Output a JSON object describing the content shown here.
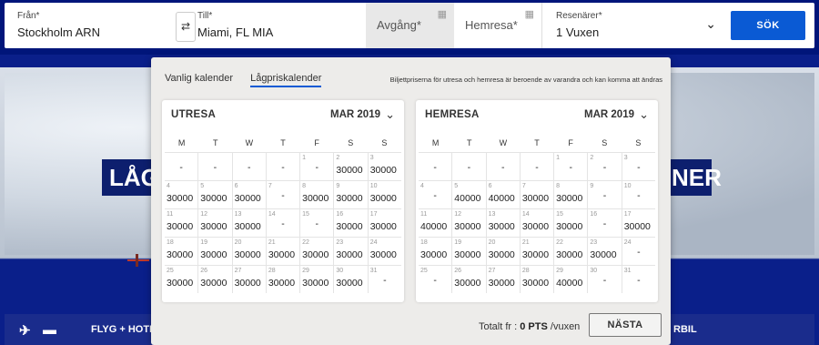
{
  "search": {
    "from_label": "Från*",
    "from_value": "Stockholm ARN",
    "to_label": "Till*",
    "to_value": "Miami, FL MIA",
    "departure_placeholder": "Avgång*",
    "return_placeholder": "Hemresa*",
    "pax_label": "Resenärer*",
    "pax_value": "1 Vuxen",
    "search_button": "SÖK"
  },
  "background": {
    "banner_left": "LÅG",
    "banner_right": "NER",
    "nav_left": "FLYG + HOTE",
    "nav_right": "RBIL"
  },
  "popup": {
    "tab_regular": "Vanlig kalender",
    "tab_lowfare": "Lågpriskalender",
    "note": "Biljettpriserna för utresa och hemresa är beroende av varandra och kan komma att ändras",
    "total_prefix": "Totalt fr :",
    "total_value": "0 PTS",
    "total_suffix": "/vuxen",
    "next_button": "NÄSTA"
  },
  "outbound": {
    "title": "UTRESA",
    "month": "MAR 2019",
    "weekdays": [
      "M",
      "T",
      "W",
      "T",
      "F",
      "S",
      "S"
    ],
    "weeks": [
      [
        {
          "d": "",
          "p": "-"
        },
        {
          "d": "",
          "p": "-"
        },
        {
          "d": "",
          "p": "-"
        },
        {
          "d": "",
          "p": "-"
        },
        {
          "d": "1",
          "p": "-"
        },
        {
          "d": "2",
          "p": "30000"
        },
        {
          "d": "3",
          "p": "30000"
        }
      ],
      [
        {
          "d": "4",
          "p": "30000"
        },
        {
          "d": "5",
          "p": "30000"
        },
        {
          "d": "6",
          "p": "30000"
        },
        {
          "d": "7",
          "p": "-"
        },
        {
          "d": "8",
          "p": "30000"
        },
        {
          "d": "9",
          "p": "30000"
        },
        {
          "d": "10",
          "p": "30000"
        }
      ],
      [
        {
          "d": "11",
          "p": "30000"
        },
        {
          "d": "12",
          "p": "30000"
        },
        {
          "d": "13",
          "p": "30000"
        },
        {
          "d": "14",
          "p": "-"
        },
        {
          "d": "15",
          "p": "-"
        },
        {
          "d": "16",
          "p": "30000"
        },
        {
          "d": "17",
          "p": "30000"
        }
      ],
      [
        {
          "d": "18",
          "p": "30000"
        },
        {
          "d": "19",
          "p": "30000"
        },
        {
          "d": "20",
          "p": "30000"
        },
        {
          "d": "21",
          "p": "30000"
        },
        {
          "d": "22",
          "p": "30000"
        },
        {
          "d": "23",
          "p": "30000"
        },
        {
          "d": "24",
          "p": "30000"
        }
      ],
      [
        {
          "d": "25",
          "p": "30000"
        },
        {
          "d": "26",
          "p": "30000"
        },
        {
          "d": "27",
          "p": "30000"
        },
        {
          "d": "28",
          "p": "30000"
        },
        {
          "d": "29",
          "p": "30000"
        },
        {
          "d": "30",
          "p": "30000"
        },
        {
          "d": "31",
          "p": "-"
        }
      ]
    ]
  },
  "inbound": {
    "title": "HEMRESA",
    "month": "MAR 2019",
    "weekdays": [
      "M",
      "T",
      "W",
      "T",
      "F",
      "S",
      "S"
    ],
    "weeks": [
      [
        {
          "d": "",
          "p": "-"
        },
        {
          "d": "",
          "p": "-"
        },
        {
          "d": "",
          "p": "-"
        },
        {
          "d": "",
          "p": "-"
        },
        {
          "d": "1",
          "p": "-"
        },
        {
          "d": "2",
          "p": "-"
        },
        {
          "d": "3",
          "p": "-"
        }
      ],
      [
        {
          "d": "4",
          "p": "-"
        },
        {
          "d": "5",
          "p": "40000"
        },
        {
          "d": "6",
          "p": "40000"
        },
        {
          "d": "7",
          "p": "30000"
        },
        {
          "d": "8",
          "p": "30000"
        },
        {
          "d": "9",
          "p": "-"
        },
        {
          "d": "10",
          "p": "-"
        }
      ],
      [
        {
          "d": "11",
          "p": "40000"
        },
        {
          "d": "12",
          "p": "30000"
        },
        {
          "d": "13",
          "p": "30000"
        },
        {
          "d": "14",
          "p": "30000"
        },
        {
          "d": "15",
          "p": "30000"
        },
        {
          "d": "16",
          "p": "-"
        },
        {
          "d": "17",
          "p": "30000"
        }
      ],
      [
        {
          "d": "18",
          "p": "30000"
        },
        {
          "d": "19",
          "p": "30000"
        },
        {
          "d": "20",
          "p": "30000"
        },
        {
          "d": "21",
          "p": "30000"
        },
        {
          "d": "22",
          "p": "30000"
        },
        {
          "d": "23",
          "p": "30000"
        },
        {
          "d": "24",
          "p": "-"
        }
      ],
      [
        {
          "d": "25",
          "p": "-"
        },
        {
          "d": "26",
          "p": "30000"
        },
        {
          "d": "27",
          "p": "30000"
        },
        {
          "d": "28",
          "p": "30000"
        },
        {
          "d": "29",
          "p": "40000"
        },
        {
          "d": "30",
          "p": "-"
        },
        {
          "d": "31",
          "p": "-"
        }
      ]
    ]
  }
}
